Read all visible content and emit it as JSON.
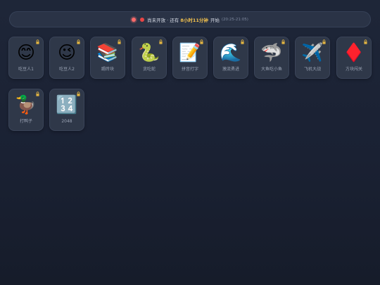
{
  "status": {
    "text_before": "尚未开放 · 还有",
    "countdown": "8小时11分钟",
    "text_after": "开始",
    "time_range": "(20:25-21:05)"
  },
  "colors": {
    "accent": "#f2c14e",
    "alert_red": "#e84545",
    "lock_gold": "#e0b341",
    "tile_bg": "#2f3849"
  },
  "games": [
    {
      "emoji": "😊",
      "label": "吃豆人1",
      "locked": true,
      "icon": "smiling-face-icon"
    },
    {
      "emoji": "😉",
      "label": "吃豆人2",
      "locked": true,
      "icon": "winking-face-icon"
    },
    {
      "emoji": "📚",
      "label": "踢砖块",
      "locked": true,
      "icon": "books-icon"
    },
    {
      "emoji": "🐍",
      "label": "贪吃蛇",
      "locked": true,
      "icon": "snake-icon"
    },
    {
      "emoji": "📝",
      "label": "拼音打字",
      "locked": true,
      "icon": "memo-icon"
    },
    {
      "emoji": "🌊",
      "label": "激流勇进",
      "locked": true,
      "icon": "wave-icon"
    },
    {
      "emoji": "🦈",
      "label": "大鱼吃小鱼",
      "locked": true,
      "icon": "shark-icon"
    },
    {
      "emoji": "✈️",
      "label": "飞机大战",
      "locked": true,
      "icon": "airplane-icon"
    },
    {
      "emoji": "♦️",
      "label": "方块闯关",
      "locked": true,
      "icon": "diamond-icon"
    },
    {
      "emoji": "🦆",
      "label": "打鸭子",
      "locked": true,
      "icon": "duck-icon"
    },
    {
      "emoji": "🔢",
      "label": "2048",
      "locked": true,
      "icon": "numbers-icon"
    }
  ]
}
